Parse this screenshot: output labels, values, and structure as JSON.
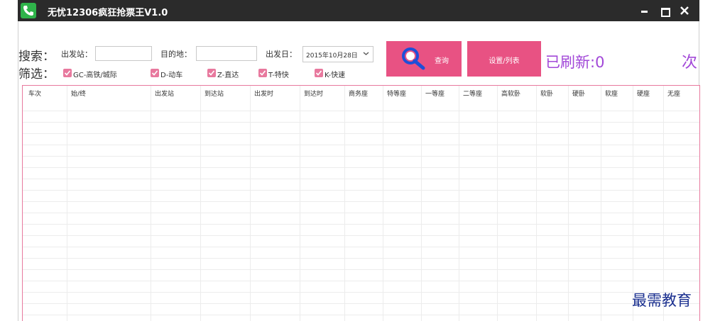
{
  "window": {
    "title": "无忧12306疯狂抢票王V1.0",
    "icon": "phone-icon",
    "accent": "#2fb34a",
    "titlebar_bg": "#2b2b2b"
  },
  "search": {
    "label": "搜索：",
    "from_label": "出发站：",
    "from_value": "",
    "to_label": "目的地：",
    "to_value": "",
    "date_label": "出发日：",
    "date_value": "2015年10月28日",
    "query_button": "查询",
    "settings_button": "设置/列表",
    "refresh_text": "已刷新:0",
    "ci_text": "次",
    "button_color": "#e85283",
    "refresh_color": "#a248d8"
  },
  "filters": {
    "label": "筛选：",
    "items": [
      {
        "label": "GC-高铁/城际",
        "checked": true
      },
      {
        "label": "D-动车",
        "checked": true
      },
      {
        "label": "Z-直达",
        "checked": true
      },
      {
        "label": "T-特快",
        "checked": true
      },
      {
        "label": "K-快速",
        "checked": true
      }
    ]
  },
  "table": {
    "columns": [
      "车次",
      "始/终",
      "出发站",
      "到达站",
      "出发时",
      "到达时",
      "商务座",
      "特等座",
      "一等座",
      "二等座",
      "高软卧",
      "软卧",
      "硬卧",
      "软座",
      "硬座",
      "无座"
    ],
    "rows": []
  },
  "watermark": "最需教育"
}
